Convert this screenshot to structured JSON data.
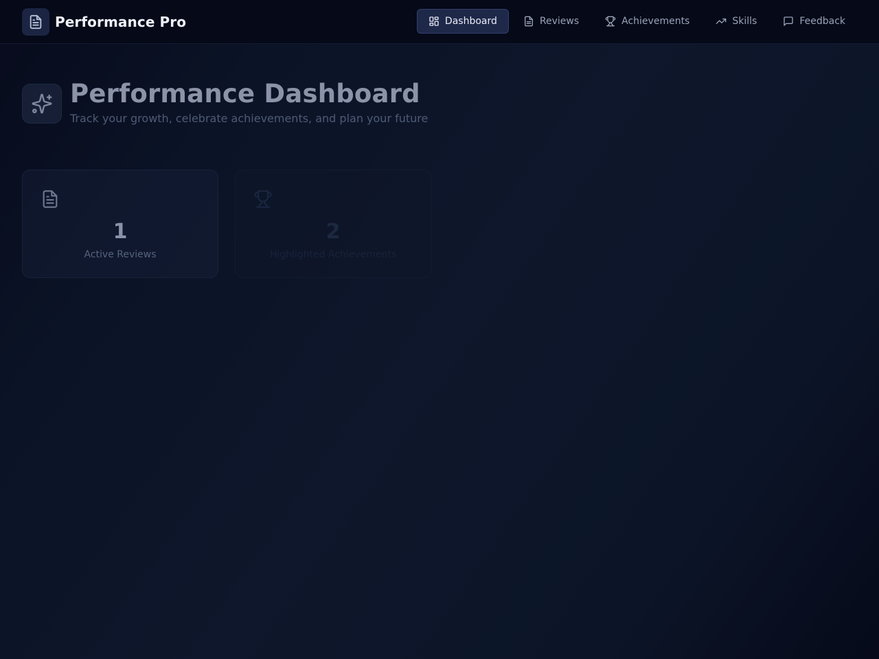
{
  "app": {
    "title": "Performance Pro",
    "logo_icon": "file-text-icon"
  },
  "nav": {
    "items": [
      {
        "label": "Dashboard",
        "icon": "grid-icon",
        "active": true
      },
      {
        "label": "Reviews",
        "icon": "file-text-icon",
        "active": false
      },
      {
        "label": "Achievements",
        "icon": "trophy-icon",
        "active": false
      },
      {
        "label": "Skills",
        "icon": "trending-up-icon",
        "active": false
      },
      {
        "label": "Feedback",
        "icon": "message-square-icon",
        "active": false
      }
    ]
  },
  "hero": {
    "icon": "sparkles-icon",
    "title": "Performance Dashboard",
    "subtitle": "Track your growth, celebrate achievements, and plan your future"
  },
  "stats": [
    {
      "value": "1",
      "label": "Active Reviews",
      "icon": "file-text-icon"
    },
    {
      "value": "2",
      "label": "Highlighted Achievements",
      "icon": "trophy-icon"
    }
  ],
  "colors": {
    "background": "#0b1326",
    "topbar": "#050918",
    "active_nav": "#1e2849",
    "text_primary": "#eef1f8",
    "text_muted": "#9aa3b8"
  }
}
